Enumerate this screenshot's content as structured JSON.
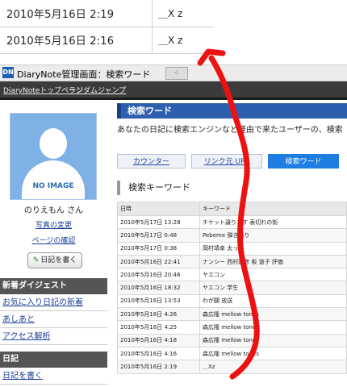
{
  "snippet": {
    "rows": [
      {
        "date": "2010年5月16日 2:19",
        "value": "＿X z"
      },
      {
        "date": "2010年5月16日 2:16",
        "value": "＿X z"
      }
    ]
  },
  "window": {
    "app_icon": "DN",
    "title": "DiaryNote管理画面：検索ワード",
    "tab2": "⁘"
  },
  "nav": {
    "links": [
      "DiaryNoteトップページ",
      "ランダムジャンプ"
    ]
  },
  "profile": {
    "no_image": "NO IMAGE",
    "name": "のりえもん さん",
    "links": [
      "写真の変更",
      "ページの確認"
    ],
    "write_button": "日記を書く"
  },
  "sidebar": {
    "sections": [
      {
        "title": "新着ダイジェスト",
        "items": [
          "お気に入り日記の新着",
          "あしあと",
          "アクセス解析"
        ]
      },
      {
        "title": "日記",
        "items": [
          "日記を書く"
        ]
      }
    ]
  },
  "main": {
    "title": "検索ワード",
    "description": "あなたの日記に検索エンジンなど経由で来たユーザーの、検索",
    "tabs": [
      {
        "label": "カウンター",
        "active": false
      },
      {
        "label": "リンク元 URL",
        "active": false
      },
      {
        "label": "検索ワード",
        "active": true
      }
    ],
    "subheading": "検索キーワード",
    "table": {
      "headers": [
        "日時",
        "キーワード"
      ],
      "rows": [
        [
          "2010年5月17日 13:28",
          "チケット譲ります 表切れの街"
        ],
        [
          "2010年5月17日 0:48",
          "Pebeme 弾き語り"
        ],
        [
          "2010年5月17日 0:38",
          "岡村靖幸 太った"
        ],
        [
          "2010年5月16日 22:41",
          "ナンシー 西村雅彦 板 道子 評価"
        ],
        [
          "2010年5月16日 20:46",
          "ヤエコン"
        ],
        [
          "2010年5月16日 18:32",
          "ヤエコン 学生"
        ],
        [
          "2010年5月16日 13:53",
          "わが闘 放送"
        ],
        [
          "2010年5月16日 4:26",
          "森広隆 mellow tones"
        ],
        [
          "2010年5月16日 4:25",
          "森広隆 mellow tones"
        ],
        [
          "2010年5月16日 4:18",
          "森広隆 mellow tones"
        ],
        [
          "2010年5月16日 4:16",
          "森広隆 mellow tones"
        ],
        [
          "2010年5月16日 2:19",
          "＿Xz"
        ]
      ]
    }
  },
  "annotation": {
    "color": "#ee1111"
  }
}
